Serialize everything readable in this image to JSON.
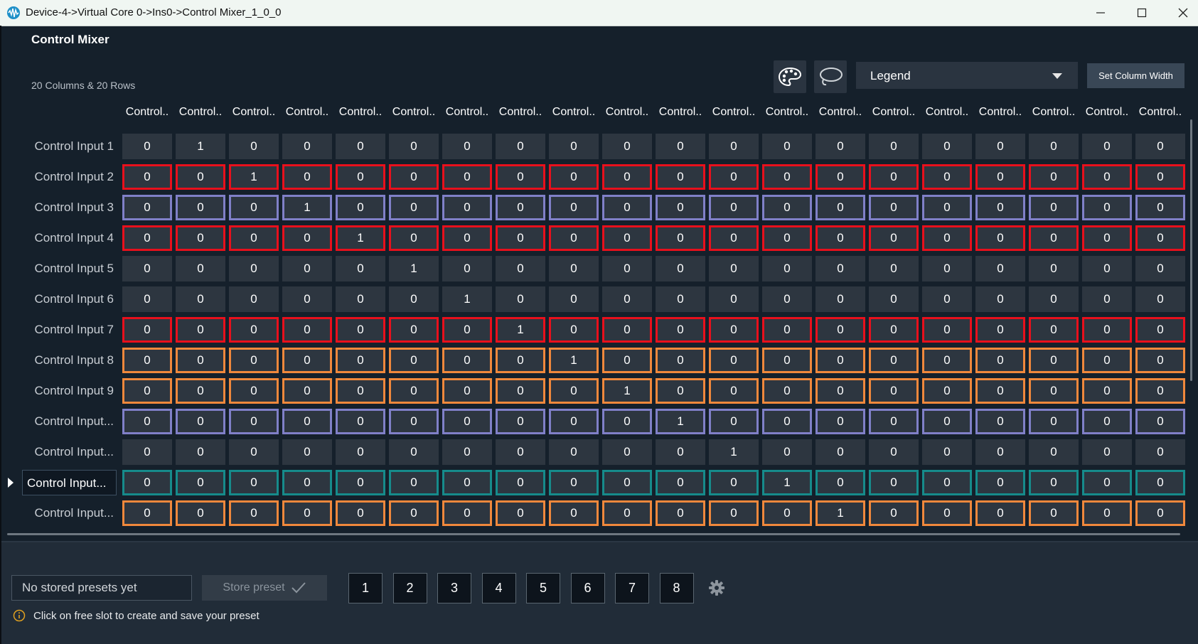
{
  "window": {
    "title": "Device-4->Virtual Core 0->Ins0->Control Mixer_1_0_0",
    "icon": "waveform-app-icon",
    "controls": [
      "minimize-icon",
      "maximize-icon",
      "close-icon"
    ]
  },
  "app": {
    "title": "Control Mixer",
    "subtitle": "20 Columns & 20 Rows"
  },
  "toolbar": {
    "palette_icon": "palette-icon",
    "lasso_icon": "lasso-icon",
    "legend_value": "Legend",
    "set_column_width_label": "Set Column Width"
  },
  "colors": {
    "red": "#e8101c",
    "violet": "#8080c8",
    "orange": "#f0883c",
    "teal": "#168b8b",
    "cell_bg": "#2d3640",
    "window_bg": "#15202b"
  },
  "grid": {
    "column_headers": [
      "Control..",
      "Control..",
      "Control..",
      "Control..",
      "Control..",
      "Control..",
      "Control..",
      "Control..",
      "Control..",
      "Control..",
      "Control..",
      "Control..",
      "Control..",
      "Control..",
      "Control..",
      "Control..",
      "Control..",
      "Control..",
      "Control..",
      "Control.."
    ],
    "rows": [
      {
        "label": "Control Input 1",
        "border": "none",
        "selected": false,
        "values": [
          "0",
          "1",
          "0",
          "0",
          "0",
          "0",
          "0",
          "0",
          "0",
          "0",
          "0",
          "0",
          "0",
          "0",
          "0",
          "0",
          "0",
          "0",
          "0",
          "0"
        ]
      },
      {
        "label": "Control Input 2",
        "border": "red",
        "selected": false,
        "values": [
          "0",
          "0",
          "1",
          "0",
          "0",
          "0",
          "0",
          "0",
          "0",
          "0",
          "0",
          "0",
          "0",
          "0",
          "0",
          "0",
          "0",
          "0",
          "0",
          "0"
        ]
      },
      {
        "label": "Control Input 3",
        "border": "violet",
        "selected": false,
        "values": [
          "0",
          "0",
          "0",
          "1",
          "0",
          "0",
          "0",
          "0",
          "0",
          "0",
          "0",
          "0",
          "0",
          "0",
          "0",
          "0",
          "0",
          "0",
          "0",
          "0"
        ]
      },
      {
        "label": "Control Input 4",
        "border": "red",
        "selected": false,
        "values": [
          "0",
          "0",
          "0",
          "0",
          "1",
          "0",
          "0",
          "0",
          "0",
          "0",
          "0",
          "0",
          "0",
          "0",
          "0",
          "0",
          "0",
          "0",
          "0",
          "0"
        ]
      },
      {
        "label": "Control Input 5",
        "border": "none",
        "selected": false,
        "values": [
          "0",
          "0",
          "0",
          "0",
          "0",
          "1",
          "0",
          "0",
          "0",
          "0",
          "0",
          "0",
          "0",
          "0",
          "0",
          "0",
          "0",
          "0",
          "0",
          "0"
        ]
      },
      {
        "label": "Control Input 6",
        "border": "none",
        "selected": false,
        "values": [
          "0",
          "0",
          "0",
          "0",
          "0",
          "0",
          "1",
          "0",
          "0",
          "0",
          "0",
          "0",
          "0",
          "0",
          "0",
          "0",
          "0",
          "0",
          "0",
          "0"
        ]
      },
      {
        "label": "Control Input 7",
        "border": "red",
        "selected": false,
        "values": [
          "0",
          "0",
          "0",
          "0",
          "0",
          "0",
          "0",
          "1",
          "0",
          "0",
          "0",
          "0",
          "0",
          "0",
          "0",
          "0",
          "0",
          "0",
          "0",
          "0"
        ]
      },
      {
        "label": "Control Input 8",
        "border": "orange",
        "selected": false,
        "values": [
          "0",
          "0",
          "0",
          "0",
          "0",
          "0",
          "0",
          "0",
          "1",
          "0",
          "0",
          "0",
          "0",
          "0",
          "0",
          "0",
          "0",
          "0",
          "0",
          "0"
        ]
      },
      {
        "label": "Control Input 9",
        "border": "orange",
        "selected": false,
        "values": [
          "0",
          "0",
          "0",
          "0",
          "0",
          "0",
          "0",
          "0",
          "0",
          "1",
          "0",
          "0",
          "0",
          "0",
          "0",
          "0",
          "0",
          "0",
          "0",
          "0"
        ]
      },
      {
        "label": "Control Input...",
        "border": "violet",
        "selected": false,
        "values": [
          "0",
          "0",
          "0",
          "0",
          "0",
          "0",
          "0",
          "0",
          "0",
          "0",
          "1",
          "0",
          "0",
          "0",
          "0",
          "0",
          "0",
          "0",
          "0",
          "0"
        ]
      },
      {
        "label": "Control Input...",
        "border": "none",
        "selected": false,
        "values": [
          "0",
          "0",
          "0",
          "0",
          "0",
          "0",
          "0",
          "0",
          "0",
          "0",
          "0",
          "1",
          "0",
          "0",
          "0",
          "0",
          "0",
          "0",
          "0",
          "0"
        ]
      },
      {
        "label": "Control Input...",
        "border": "teal",
        "selected": true,
        "values": [
          "0",
          "0",
          "0",
          "0",
          "0",
          "0",
          "0",
          "0",
          "0",
          "0",
          "0",
          "0",
          "1",
          "0",
          "0",
          "0",
          "0",
          "0",
          "0",
          "0"
        ]
      },
      {
        "label": "Control Input...",
        "border": "orange",
        "selected": false,
        "values": [
          "0",
          "0",
          "0",
          "0",
          "0",
          "0",
          "0",
          "0",
          "0",
          "0",
          "0",
          "0",
          "0",
          "1",
          "0",
          "0",
          "0",
          "0",
          "0",
          "0"
        ]
      }
    ]
  },
  "presets": {
    "name_value": "No stored presets yet",
    "store_label": "Store preset",
    "store_icon": "checkmark-icon",
    "slots": [
      "1",
      "2",
      "3",
      "4",
      "5",
      "6",
      "7",
      "8"
    ],
    "settings_icon": "gear-icon",
    "info_icon": "info-icon",
    "info_text": "Click on free slot to create and save your preset"
  }
}
